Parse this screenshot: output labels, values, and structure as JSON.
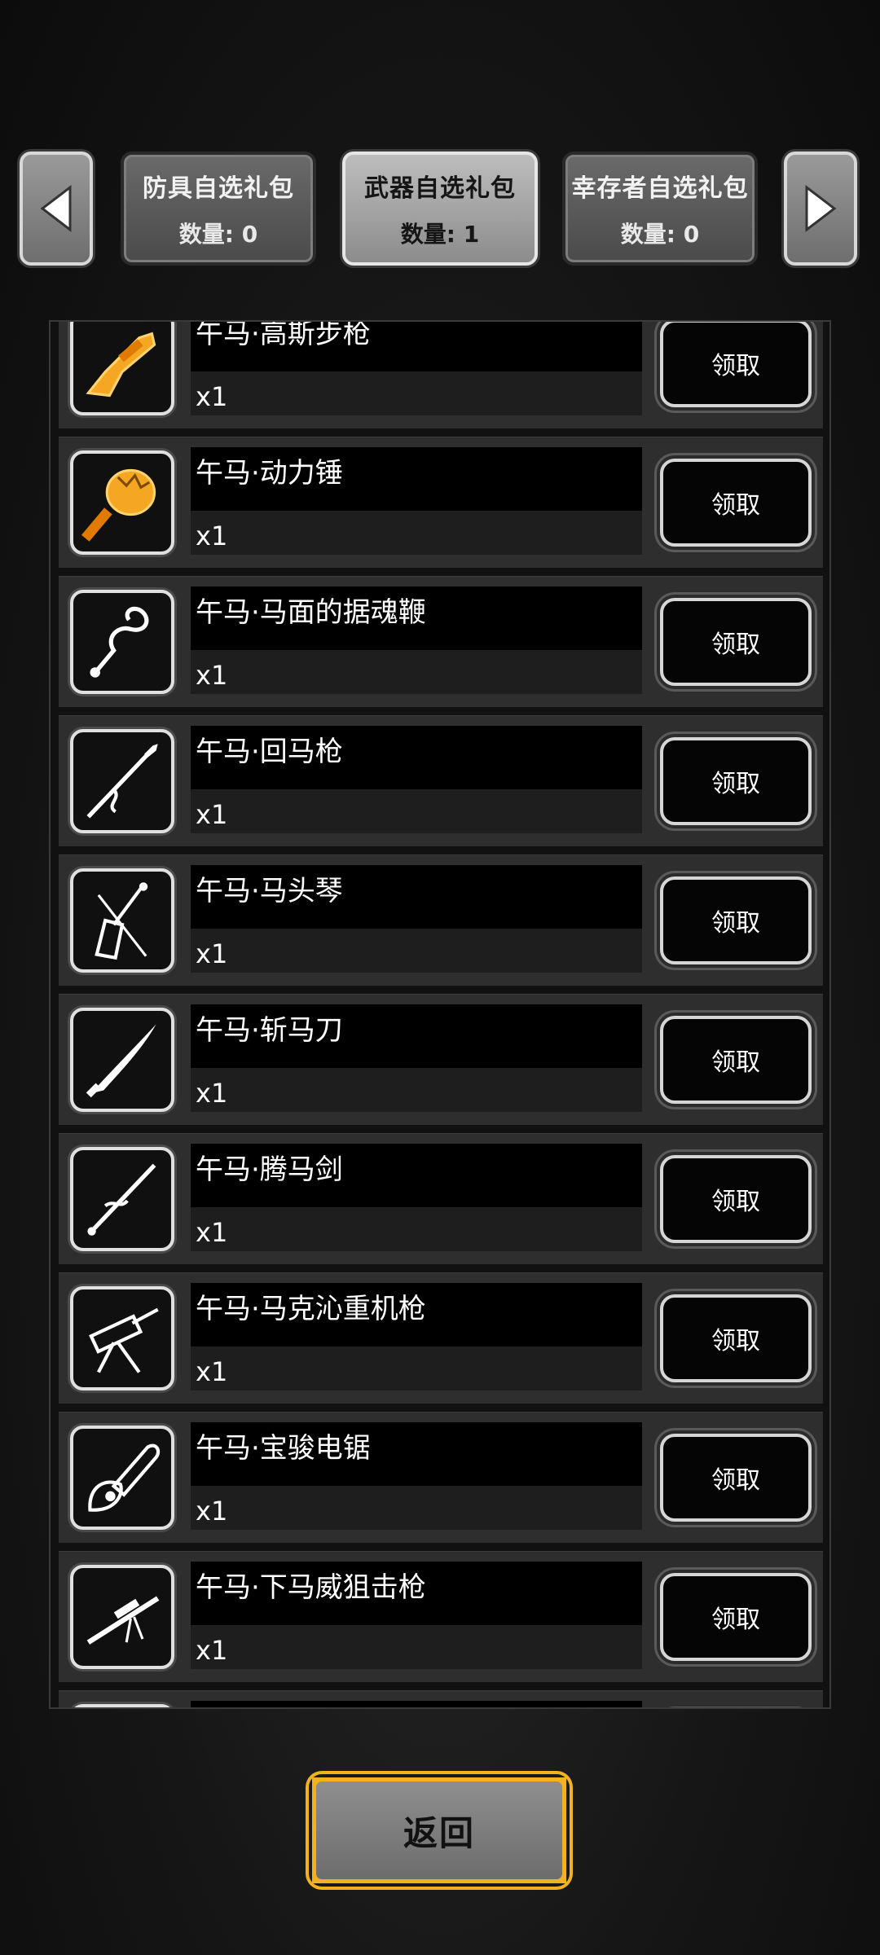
{
  "tabs": [
    {
      "title": "防具自选礼包",
      "count": "数量: 0"
    },
    {
      "title": "武器自选礼包",
      "count": "数量: 1"
    },
    {
      "title": "幸存者自选礼包",
      "count": "数量: 0"
    }
  ],
  "items": [
    {
      "name": "午马·高斯步枪",
      "qty": "x1",
      "button": "领取",
      "icon": "golden-rifle-icon"
    },
    {
      "name": "午马·动力锤",
      "qty": "x1",
      "button": "领取",
      "icon": "golden-hammer-icon"
    },
    {
      "name": "午马·马面的据魂鞭",
      "qty": "x1",
      "button": "领取",
      "icon": "whip-icon"
    },
    {
      "name": "午马·回马枪",
      "qty": "x1",
      "button": "领取",
      "icon": "spear-icon"
    },
    {
      "name": "午马·马头琴",
      "qty": "x1",
      "button": "领取",
      "icon": "horsehead-fiddle-icon"
    },
    {
      "name": "午马·斩马刀",
      "qty": "x1",
      "button": "领取",
      "icon": "saber-icon"
    },
    {
      "name": "午马·腾马剑",
      "qty": "x1",
      "button": "领取",
      "icon": "sword-icon"
    },
    {
      "name": "午马·马克沁重机枪",
      "qty": "x1",
      "button": "领取",
      "icon": "heavy-machine-gun-icon"
    },
    {
      "name": "午马·宝骏电锯",
      "qty": "x1",
      "button": "领取",
      "icon": "chainsaw-icon"
    },
    {
      "name": "午马·下马威狙击枪",
      "qty": "x1",
      "button": "领取",
      "icon": "sniper-rifle-icon"
    }
  ],
  "back_label": "返回",
  "colors": {
    "accent": "#f2b21f",
    "background": "#161616"
  }
}
